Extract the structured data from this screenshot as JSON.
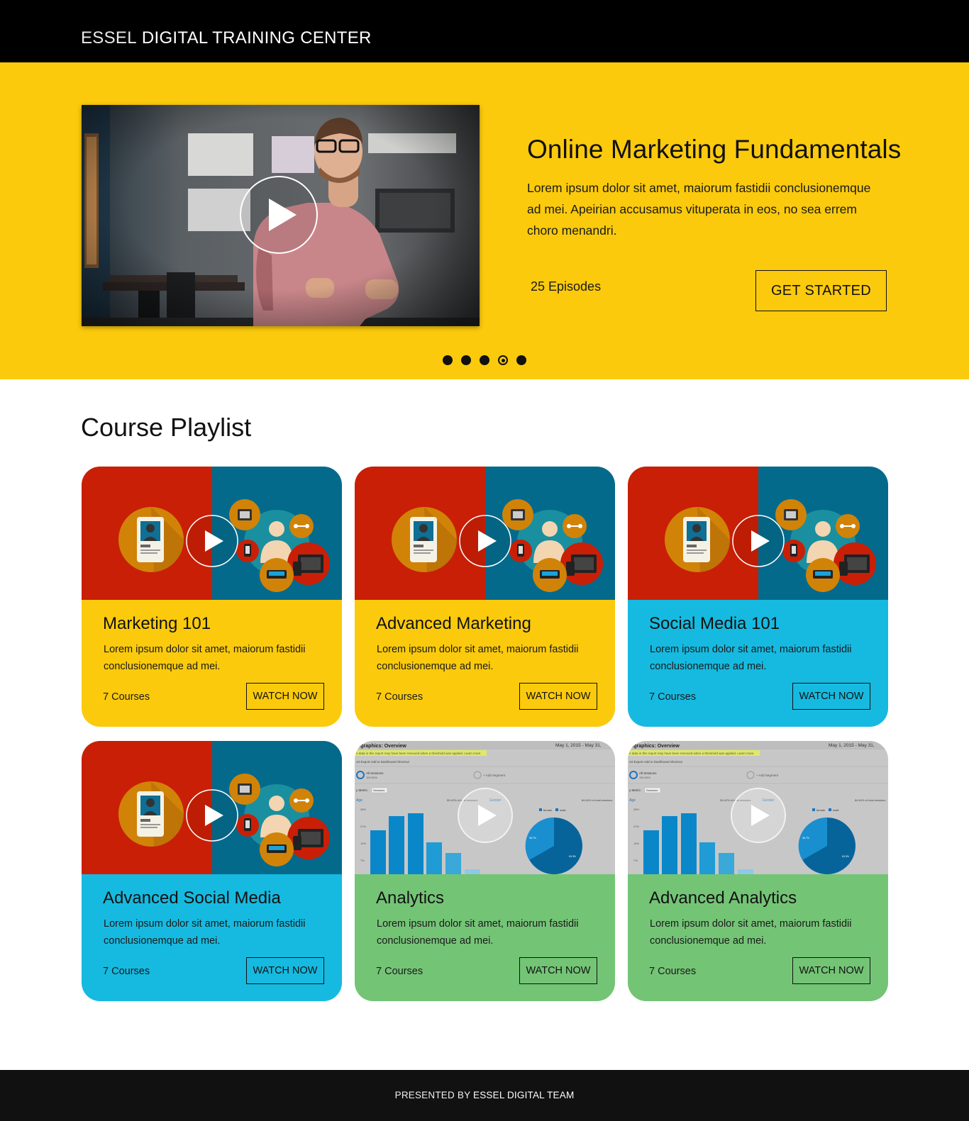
{
  "header": {
    "brand_light": "ESSEL",
    "brand_bold": "DIGITAL TRAINING CENTER"
  },
  "hero": {
    "title": "Online Marketing Fundamentals",
    "description": "Lorem ipsum dolor sit amet, maiorum fastidii conclusionemque ad mei. Apeirian accusamus vituperata in eos, no sea errem choro menandri.",
    "episodes": "25 Episodes",
    "cta_label": "GET STARTED",
    "carousel_active_index": 3,
    "carousel_count": 5
  },
  "playlist": {
    "heading": "Course Playlist",
    "cards": [
      {
        "title": "Marketing 101",
        "description": "Lorem ipsum dolor sit amet, maiorum fastidii conclusionemque ad mei.",
        "count": "7 Courses",
        "button": "WATCH NOW",
        "color": "#fbca0c",
        "thumbnail": "marketing-illustration"
      },
      {
        "title": "Advanced Marketing",
        "description": "Lorem ipsum dolor sit amet, maiorum fastidii conclusionemque ad mei.",
        "count": "7 Courses",
        "button": "WATCH NOW",
        "color": "#fbca0c",
        "thumbnail": "marketing-illustration"
      },
      {
        "title": "Social Media 101",
        "description": "Lorem ipsum dolor sit amet, maiorum fastidii conclusionemque ad mei.",
        "count": "7 Courses",
        "button": "WATCH NOW",
        "color": "#16bae0",
        "thumbnail": "marketing-illustration"
      },
      {
        "title": "Advanced Social Media",
        "description": "Lorem ipsum dolor sit amet, maiorum fastidii conclusionemque ad mei.",
        "count": "7 Courses",
        "button": "WATCH NOW",
        "color": "#16bae0",
        "thumbnail": "marketing-illustration"
      },
      {
        "title": "Analytics",
        "description": "Lorem ipsum dolor sit amet, maiorum fastidii conclusionemque ad mei.",
        "count": "7 Courses",
        "button": "WATCH NOW",
        "color": "#74c476",
        "thumbnail": "analytics-screenshot"
      },
      {
        "title": "Advanced Analytics",
        "description": "Lorem ipsum dolor sit amet, maiorum fastidii conclusionemque ad mei.",
        "count": "7 Courses",
        "button": "WATCH NOW",
        "color": "#74c476",
        "thumbnail": "analytics-screenshot"
      }
    ]
  },
  "analytics_thumb": {
    "report_title": "ographics: Overview",
    "date_range": "May 1, 2015 - May 31,",
    "notice": "e data in this report may have been removed when a threshold was applied. Learn more",
    "toolbar": [
      "ort",
      "Export",
      "Add to Dashboard",
      "Shortcut"
    ],
    "segment_all": "All Sessions",
    "segment_all_pct": "100.00%",
    "segment_add": "+ Add Segment",
    "metric_label": "y Metric:",
    "metric_value": "Sessions",
    "age_label": "Age",
    "age_pct": "55.42% of total sessions",
    "gender_label": "Gender",
    "gender_pct": "84.84% of total sessions",
    "legend_female": "female",
    "legend_male": "male",
    "y_ticks": [
      "28%",
      "21%",
      "14%",
      "7%"
    ],
    "pie_label_a": "36.7%",
    "pie_label_b": "63.3%"
  },
  "footer": {
    "prefix": "PRESENTED BY",
    "team": "ESSEL DIGITAL TEAM"
  }
}
